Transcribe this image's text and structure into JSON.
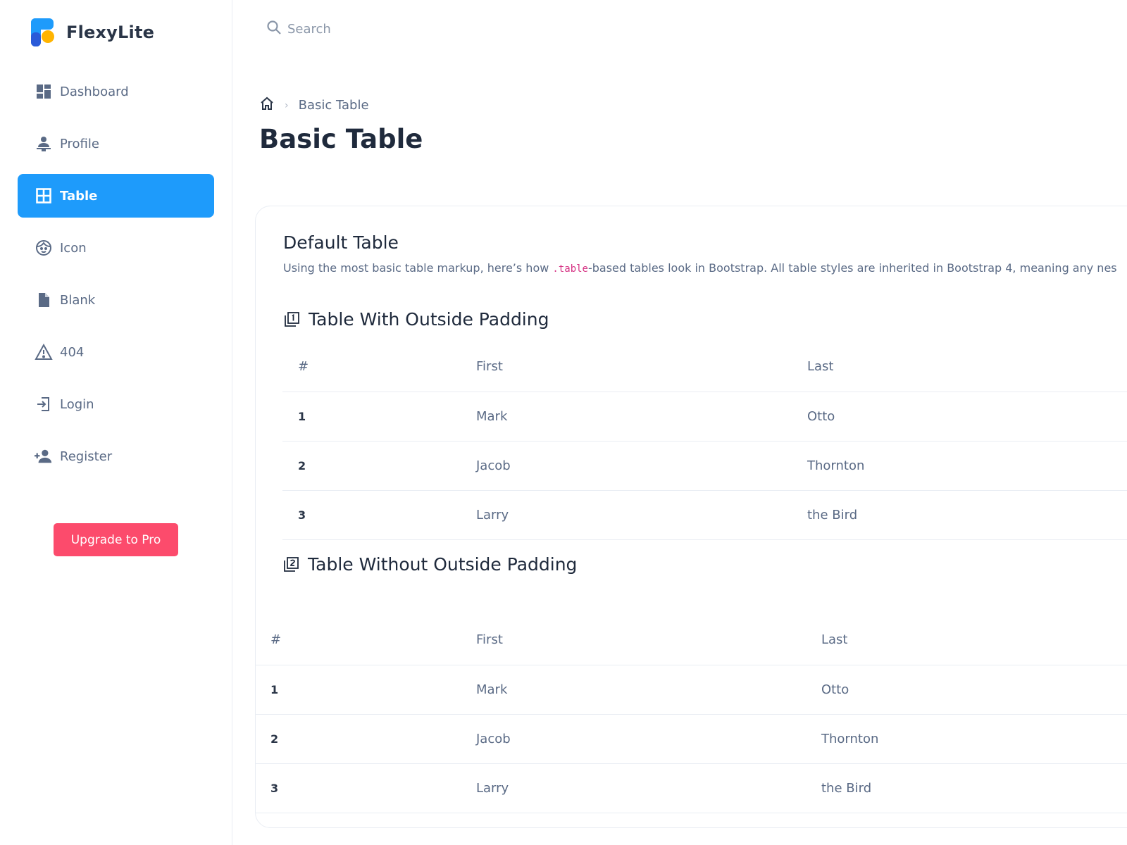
{
  "brand": {
    "name": "FlexyLite"
  },
  "sidebar": {
    "items": [
      {
        "label": "Dashboard",
        "icon": "dashboard-icon",
        "active": false
      },
      {
        "label": "Profile",
        "icon": "profile-icon",
        "active": false
      },
      {
        "label": "Table",
        "icon": "table-icon",
        "active": true
      },
      {
        "label": "Icon",
        "icon": "face-icon",
        "active": false
      },
      {
        "label": "Blank",
        "icon": "file-icon",
        "active": false
      },
      {
        "label": "404",
        "icon": "warning-icon",
        "active": false
      },
      {
        "label": "Login",
        "icon": "login-icon",
        "active": false
      },
      {
        "label": "Register",
        "icon": "add-user-icon",
        "active": false
      }
    ],
    "upgrade_label": "Upgrade to Pro"
  },
  "search": {
    "placeholder": "Search"
  },
  "breadcrumb": {
    "current": "Basic Table"
  },
  "page": {
    "title": "Basic Table"
  },
  "card": {
    "title": "Default Table",
    "sub_before": "Using the most basic table markup, here’s how ",
    "sub_code": ".table",
    "sub_after": "-based tables look in Bootstrap. All table styles are inherited in Bootstrap 4, meaning any nes"
  },
  "table_outside": {
    "title": "Table With Outside Padding",
    "headers": [
      "#",
      "First",
      "Last"
    ],
    "rows": [
      [
        "1",
        "Mark",
        "Otto"
      ],
      [
        "2",
        "Jacob",
        "Thornton"
      ],
      [
        "3",
        "Larry",
        "the Bird"
      ]
    ]
  },
  "table_without": {
    "title": "Table Without Outside Padding",
    "headers": [
      "#",
      "First",
      "Last"
    ],
    "rows": [
      [
        "1",
        "Mark",
        "Otto"
      ],
      [
        "2",
        "Jacob",
        "Thornton"
      ],
      [
        "3",
        "Larry",
        "the Bird"
      ]
    ]
  },
  "colors": {
    "accent": "#1e9bfb",
    "upgrade": "#fc4b6c",
    "text": "#5a6a85",
    "heading": "#1f2a3c"
  }
}
